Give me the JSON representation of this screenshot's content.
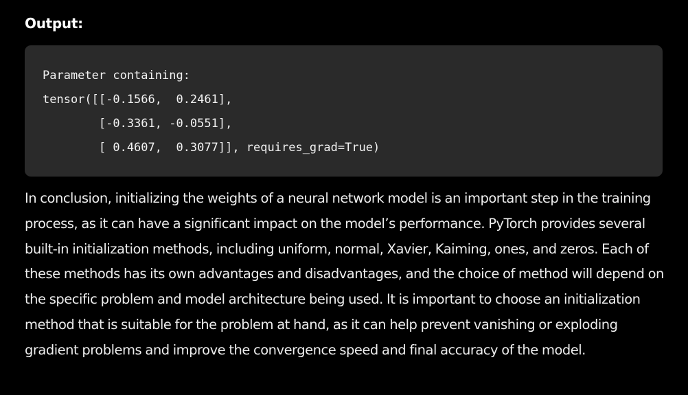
{
  "output_heading": "Output:",
  "code_block": {
    "lines": [
      "Parameter containing:",
      "tensor([[-0.1566,  0.2461],",
      "        [-0.3361, -0.0551],",
      "        [ 0.4607,  0.3077]], requires_grad=True)"
    ]
  },
  "conclusion_paragraph": "In conclusion, initializing the weights of a neural network model is an important step in the training process, as it can have a significant impact on the model’s performance. PyTorch provides several built-in initialization methods, including uniform, normal, Xavier, Kaiming, ones, and zeros. Each of these methods has its own advantages and disadvantages, and the choice of method will depend on the specific problem and model architecture being used. It is important to choose an initialization method that is suitable for the problem at hand, as it can help prevent vanishing or exploding gradient problems and improve the convergence speed and final accuracy of the model.",
  "colors": {
    "background": "#000000",
    "code_background": "#2a2a2a",
    "text": "#ededed"
  }
}
